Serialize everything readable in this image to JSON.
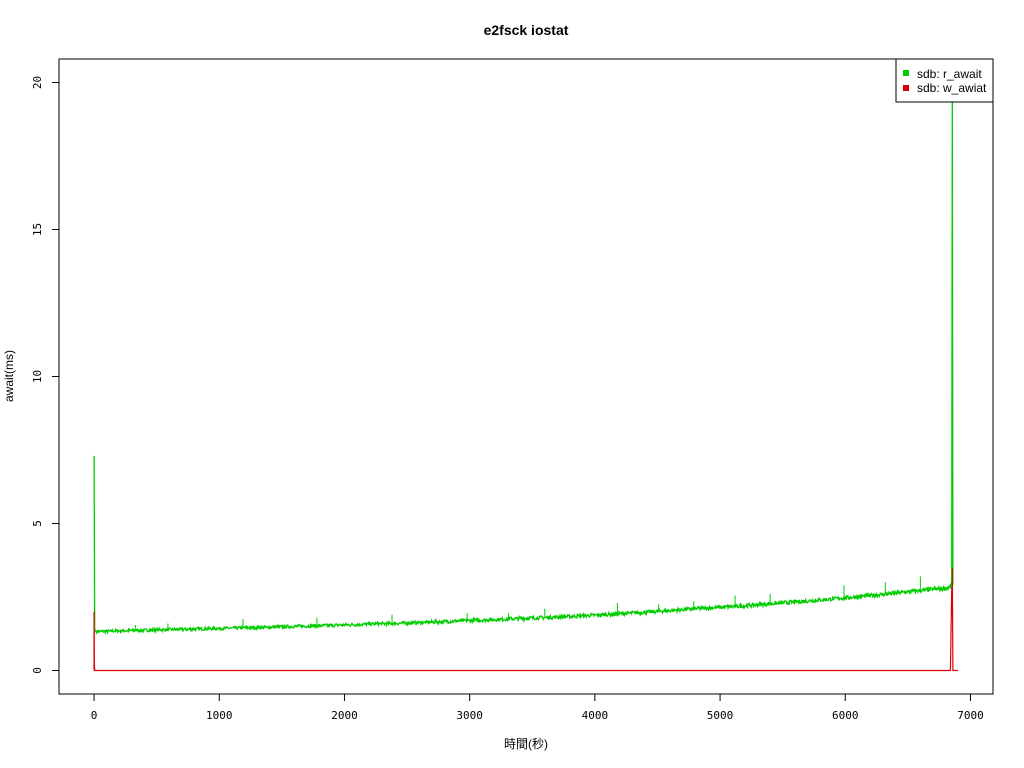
{
  "chart_data": {
    "type": "line",
    "title": "e2fsck iostat",
    "xlabel": "時間(秒)",
    "ylabel": "await(ms)",
    "xlim": [
      -280,
      7180
    ],
    "ylim": [
      -0.8,
      20.8
    ],
    "xticks": [
      0,
      1000,
      2000,
      3000,
      4000,
      5000,
      6000,
      7000
    ],
    "yticks": [
      0,
      5,
      10,
      15,
      20
    ],
    "grid": false,
    "legend_position": "top-right",
    "series": [
      {
        "name": "sdb: r_await",
        "color": "#00cc00",
        "x": [
          0,
          5,
          10,
          20,
          100,
          200,
          300,
          400,
          500,
          600,
          700,
          800,
          900,
          1000,
          1200,
          1400,
          1600,
          1800,
          2000,
          2200,
          2400,
          2600,
          2800,
          3000,
          3200,
          3400,
          3600,
          3800,
          4000,
          4200,
          4400,
          4600,
          4800,
          5000,
          5200,
          5400,
          5600,
          5800,
          6000,
          6200,
          6400,
          6600,
          6800,
          6850,
          6855,
          6860
        ],
        "y": [
          7.3,
          1.4,
          1.35,
          1.33,
          1.33,
          1.35,
          1.36,
          1.37,
          1.38,
          1.39,
          1.4,
          1.41,
          1.42,
          1.43,
          1.45,
          1.47,
          1.5,
          1.52,
          1.55,
          1.58,
          1.6,
          1.63,
          1.66,
          1.7,
          1.73,
          1.77,
          1.8,
          1.84,
          1.88,
          1.93,
          1.98,
          2.04,
          2.1,
          2.15,
          2.2,
          2.27,
          2.33,
          2.4,
          2.47,
          2.55,
          2.63,
          2.72,
          2.8,
          2.85,
          19.5,
          2.9
        ],
        "spikes": [
          {
            "x": 330,
            "y": 1.55
          },
          {
            "x": 590,
            "y": 1.6
          },
          {
            "x": 1190,
            "y": 1.75
          },
          {
            "x": 1780,
            "y": 1.8
          },
          {
            "x": 2380,
            "y": 1.9
          },
          {
            "x": 2980,
            "y": 1.95
          },
          {
            "x": 3310,
            "y": 1.95
          },
          {
            "x": 3600,
            "y": 2.1
          },
          {
            "x": 4180,
            "y": 2.3
          },
          {
            "x": 4510,
            "y": 2.25
          },
          {
            "x": 4790,
            "y": 2.35
          },
          {
            "x": 5120,
            "y": 2.55
          },
          {
            "x": 5400,
            "y": 2.6
          },
          {
            "x": 5990,
            "y": 2.9
          },
          {
            "x": 6320,
            "y": 3.0
          },
          {
            "x": 6600,
            "y": 3.2
          }
        ]
      },
      {
        "name": "sdb: w_awiat",
        "color": "#dd0000",
        "x": [
          0,
          2,
          5,
          100,
          1000,
          2000,
          3000,
          4000,
          5000,
          6000,
          6840,
          6850,
          6855,
          6860,
          6900
        ],
        "y": [
          2.0,
          0.3,
          0,
          0,
          0,
          0,
          0,
          0,
          0,
          0,
          0,
          2.7,
          3.5,
          0,
          0
        ]
      }
    ]
  }
}
